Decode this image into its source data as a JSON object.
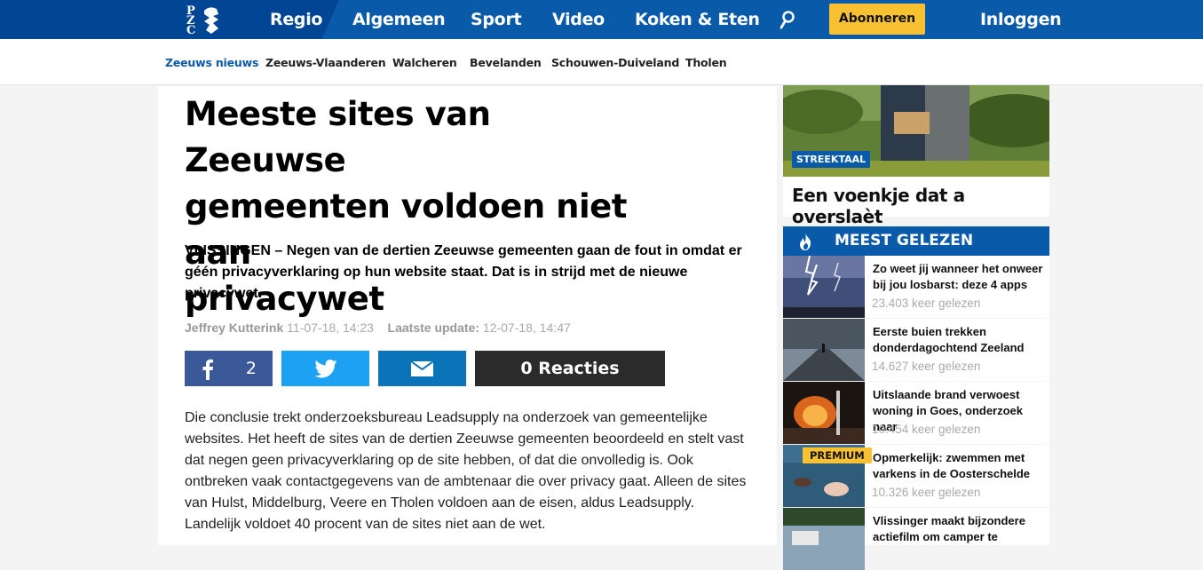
{
  "logo": {
    "letters": [
      "P",
      "Z",
      "C"
    ]
  },
  "nav": {
    "items": [
      "Regio",
      "Algemeen",
      "Sport",
      "Video",
      "Koken & Eten"
    ],
    "subscribe": "Abonneren",
    "login": "Inloggen"
  },
  "subnav": [
    "Zeeuws nieuws",
    "Zeeuws-Vlaanderen",
    "Walcheren",
    "Bevelanden",
    "Schouwen-Duiveland",
    "Tholen"
  ],
  "article": {
    "headline_lines": [
      "Meeste sites van Zeeuwse",
      "gemeenten voldoen niet aan",
      "privacywet"
    ],
    "intro_lines": [
      "VLISSINGEN – Negen van de dertien Zeeuwse gemeenten gaan de fout in omdat er",
      "géén privacyverklaring op hun website staat. Dat is in strijd met de nieuwe",
      "privacywet."
    ],
    "author": "Jeffrey Kutterink",
    "published": "11-07-18, 14:23",
    "update_label": "Laatste update:",
    "updated": "12-07-18, 14:47",
    "facebook_count": "2",
    "reactions": "0 Reacties",
    "body_lines": [
      "Die conclusie trekt onderzoeksbureau Leadsupply na onderzoek van gemeentelijke",
      "websites. Het heeft de sites van de dertien Zeeuwse gemeenten beoordeeld en stelt vast",
      "dat negen geen privacyverklaring op de site hebben, of dat die onvolledig is. Ook",
      "ontbreken vaak contactgegevens van de ambtenaar die over privacy gaat. Alleen de sites",
      "van Hulst, Middelburg, Veere en Tholen voldoen aan de eisen, aldus Leadsupply.",
      "Landelijk voldoet 40 procent van de sites niet aan de wet."
    ]
  },
  "sidebar": {
    "featured": {
      "tag": "STREEKTAAL",
      "title": "Een voenkje dat a overslaèt"
    },
    "most_read_title": "MEEST GELEZEN",
    "most_read": [
      {
        "title_lines": [
          "Zo weet jij wanneer het onweer",
          "bij jou losbarst: deze 4 apps"
        ],
        "count": "23.403 keer gelezen"
      },
      {
        "title_lines": [
          "Eerste buien trekken",
          "donderdagochtend Zeeland"
        ],
        "count": "14.627 keer gelezen"
      },
      {
        "title_lines": [
          "Uitslaande brand verwoest",
          "woning in Goes, onderzoek naar"
        ],
        "count": "10.454 keer gelezen"
      },
      {
        "title_lines": [
          "Opmerkelijk: zwemmen met",
          "varkens in de Oosterschelde"
        ],
        "count": "10.326 keer gelezen",
        "badge": "PREMIUM"
      },
      {
        "title_lines": [
          "Vlissinger maakt bijzondere",
          "actiefilm om camper te"
        ],
        "count": ""
      }
    ]
  },
  "colors": {
    "brand_blue": "#0a5aaa",
    "dark_blue": "#004694",
    "accent_yellow": "#f7c132",
    "facebook": "#3b5998",
    "twitter": "#1da1f2",
    "mail": "#0b73b7"
  }
}
